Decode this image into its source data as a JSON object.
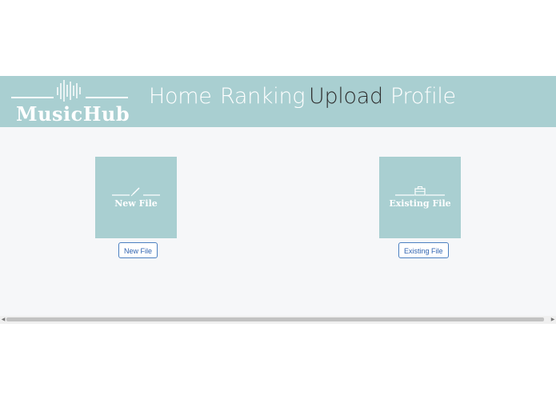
{
  "brand": {
    "name": "MusicHub",
    "logo_icon": "soundwave-icon"
  },
  "nav": {
    "items": [
      {
        "label": "Home",
        "active": false
      },
      {
        "label": "Ranking",
        "active": false
      },
      {
        "label": "Upload",
        "active": true
      },
      {
        "label": "Profile",
        "active": false
      }
    ]
  },
  "upload": {
    "new_file": {
      "card_label": "New File",
      "button_label": "New File",
      "icon": "pen-icon"
    },
    "existing_file": {
      "card_label": "Existing File",
      "button_label": "Existing File",
      "icon": "briefcase-icon"
    }
  },
  "colors": {
    "accent": "#a9cfd1",
    "active_nav": "#2f2f2f",
    "button_text": "#2f63b0",
    "content_bg": "#f6f7f9"
  },
  "scrollbar": {
    "left_icon": "scroll-left-arrow-icon",
    "right_icon": "scroll-right-arrow-icon"
  }
}
